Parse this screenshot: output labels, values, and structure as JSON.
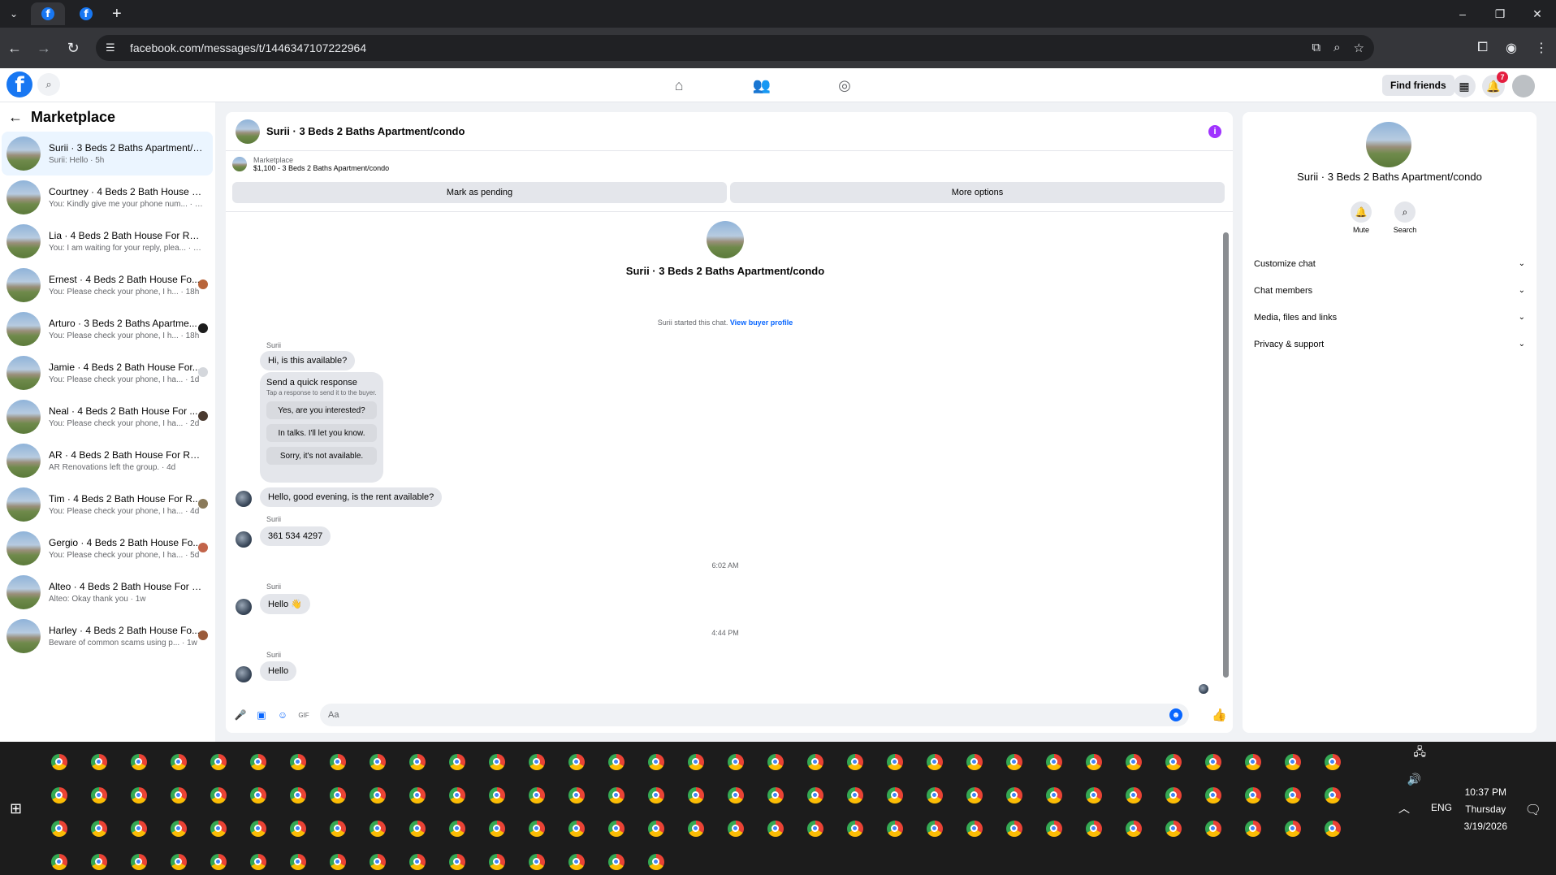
{
  "browser": {
    "url": "facebook.com/messages/t/1446347107222964"
  },
  "fbnav": {
    "find_friends": "Find friends",
    "notification_count": "7"
  },
  "sidebar": {
    "title": "Marketplace",
    "items": [
      {
        "name": "Surii · 3 Beds 2 Baths Apartment/c...",
        "preview": "Surii: Hello · 5h",
        "active": true
      },
      {
        "name": "Courtney · 4 Beds 2 Bath House Fo...",
        "preview": "You: Kindly give me your phone num... · 18h"
      },
      {
        "name": "Lia · 4 Beds 2 Bath House For Rent",
        "preview": "You: I am waiting for your reply, plea... · 18h"
      },
      {
        "name": "Ernest · 4 Beds 2 Bath House Fo...",
        "preview": "You: Please check your phone, I h... · 18h"
      },
      {
        "name": "Arturo · 3 Beds 2 Baths Apartme...",
        "preview": "You: Please check your phone, I h... · 18h"
      },
      {
        "name": "Jamie · 4 Beds 2 Bath House For...",
        "preview": "You: Please check your phone, I ha... · 1d"
      },
      {
        "name": "Neal · 4 Beds 2 Bath House For ...",
        "preview": "You: Please check your phone, I ha... · 2d"
      },
      {
        "name": "AR · 4 Beds 2 Bath House For Rent",
        "preview": "AR Renovations left the group. · 4d"
      },
      {
        "name": "Tim · 4 Beds 2 Bath House For R...",
        "preview": "You: Please check your phone, I ha... · 4d"
      },
      {
        "name": "Gergio · 4 Beds 2 Bath House Fo...",
        "preview": "You: Please check your phone, I ha... · 5d"
      },
      {
        "name": "Alteo · 4 Beds 2 Bath House For Re...",
        "preview": "Alteo: Okay thank you · 1w"
      },
      {
        "name": "Harley · 4 Beds 2 Bath House Fo...",
        "preview": "Beware of common scams using p... · 1w"
      }
    ]
  },
  "chat": {
    "title": "Surii · 3 Beds 2 Baths Apartment/condo",
    "listing_label": "Marketplace",
    "listing_price": "$1,100 - 3 Beds 2 Baths Apartment/condo",
    "mark_pending": "Mark as pending",
    "more_options": "More options",
    "hero_name": "Surii · 3 Beds 2 Baths Apartment/condo",
    "started_text": "Surii started this chat.",
    "view_profile": "View buyer profile",
    "sender": "Surii",
    "msg1": "Hi, is this available?",
    "qr_title": "Send a quick response",
    "qr_sub": "Tap a response to send it to the buyer.",
    "qr_options": [
      "Yes, are you interested?",
      "In talks. I'll let you know.",
      "Sorry, it's not available."
    ],
    "msg2": "Hello, good evening, is the rent available?",
    "msg3": "361 534 4297",
    "time1": "6:02 AM",
    "msg4": "Hello 👋",
    "time2": "4:44 PM",
    "msg5": "Hello",
    "composer_placeholder": "Aa"
  },
  "info": {
    "name": "Surii · 3 Beds 2 Baths Apartment/condo",
    "mute": "Mute",
    "search": "Search",
    "rows": [
      "Customize chat",
      "Chat members",
      "Media, files and links",
      "Privacy & support"
    ]
  },
  "taskbar": {
    "lang": "ENG",
    "time": "10:37 PM",
    "day": "Thursday",
    "date": "3/19/2026"
  }
}
